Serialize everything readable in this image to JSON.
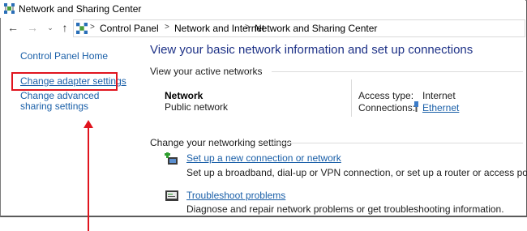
{
  "window": {
    "title": "Network and Sharing Center"
  },
  "breadcrumb": [
    "Control Panel",
    "Network and Internet",
    "Network and Sharing Center"
  ],
  "left_pane": {
    "home": "Control Panel Home",
    "change_adapter": "Change adapter settings",
    "change_advanced": "Change advanced sharing settings"
  },
  "main": {
    "heading": "View your basic network information and set up connections",
    "active_networks_label": "View your active networks",
    "network": {
      "name": "Network",
      "type": "Public network",
      "access_type_label": "Access type:",
      "access_type_value": "Internet",
      "connections_label": "Connections:",
      "connections_value": "Ethernet"
    },
    "change_settings_label": "Change your networking settings",
    "tasks": [
      {
        "link": "Set up a new connection or network",
        "desc": "Set up a broadband, dial-up or VPN connection, or set up a router or access point."
      },
      {
        "link": "Troubleshoot problems",
        "desc": "Diagnose and repair network problems or get troubleshooting information."
      }
    ]
  },
  "annotation": {
    "highlight_color": "#e0141e"
  },
  "icons": [
    "network-center-icon",
    "back-arrow-icon",
    "forward-arrow-icon",
    "recent-locations-icon",
    "up-arrow-icon",
    "ethernet-icon",
    "new-connection-icon",
    "troubleshoot-icon"
  ]
}
